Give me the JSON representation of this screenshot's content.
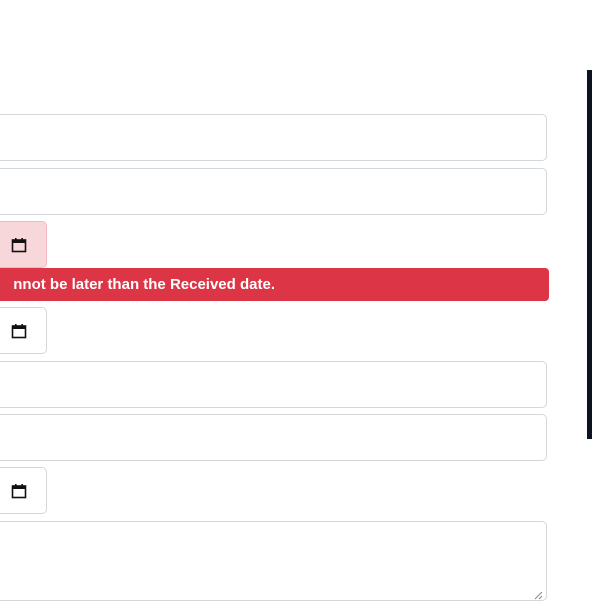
{
  "form": {
    "fields": [
      {
        "value": "",
        "placeholder": ""
      },
      {
        "value": "",
        "placeholder": ""
      },
      {
        "value": "",
        "placeholder": ""
      },
      {
        "value": "",
        "placeholder": ""
      }
    ],
    "date_pickers": [
      {
        "icon": "calendar-icon",
        "invalid": true
      },
      {
        "icon": "calendar-icon",
        "invalid": false
      },
      {
        "icon": "calendar-icon",
        "invalid": false
      }
    ],
    "error_message": "nnot be later than the Received date.",
    "notes": {
      "value": "",
      "placeholder": ""
    }
  },
  "colors": {
    "error": "#dc3545",
    "invalid_bg": "#f8d7da",
    "border": "#d3d6da",
    "side_panel": "#0e1322"
  }
}
